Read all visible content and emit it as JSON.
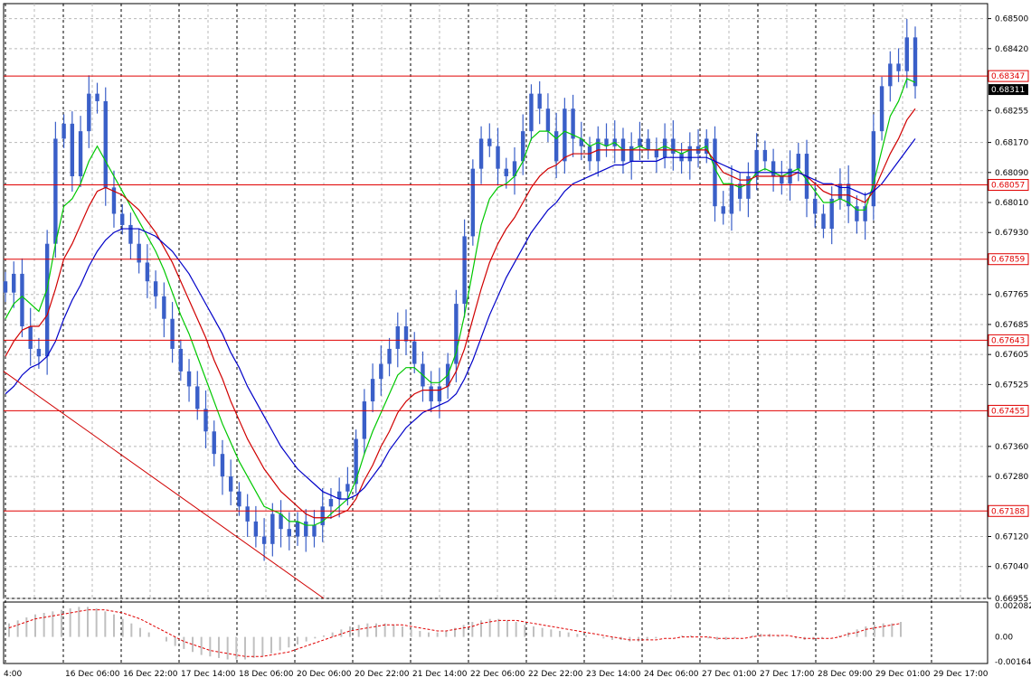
{
  "chart_data": [
    {
      "type": "candlestick",
      "instrument_panel": "main",
      "ylim": [
        0.66955,
        0.6854
      ],
      "y_ticks": [
        "0.68500",
        "0.68420",
        "0.68255",
        "0.68170",
        "0.68090",
        "0.68010",
        "0.67930",
        "0.67765",
        "0.67685",
        "0.67605",
        "0.67525",
        "0.67360",
        "0.67280",
        "0.67120",
        "0.67040",
        "0.66955"
      ],
      "x_ticks": [
        "4:00",
        "16 Dec 06:00",
        "16 Dec 22:00",
        "17 Dec 14:00",
        "18 Dec 06:00",
        "20 Dec 06:00",
        "20 Dec 22:00",
        "21 Dec 14:00",
        "22 Dec 06:00",
        "22 Dec 22:00",
        "23 Dec 14:00",
        "24 Dec 06:00",
        "27 Dec 01:00",
        "27 Dec 17:00",
        "28 Dec 09:00",
        "29 Dec 01:00",
        "29 Dec 17:00"
      ],
      "horizontal_levels": [
        "0.68347",
        "0.68057",
        "0.67859",
        "0.67643",
        "0.67455",
        "0.67188"
      ],
      "current_price": "0.68311",
      "close_series": [
        0.6777,
        0.6782,
        0.6768,
        0.6762,
        0.676,
        0.679,
        0.6818,
        0.6822,
        0.6808,
        0.682,
        0.683,
        0.6828,
        0.6805,
        0.6798,
        0.6795,
        0.679,
        0.6785,
        0.678,
        0.6776,
        0.677,
        0.6762,
        0.6756,
        0.6752,
        0.6746,
        0.674,
        0.6734,
        0.6728,
        0.6724,
        0.672,
        0.6716,
        0.6712,
        0.671,
        0.6718,
        0.6714,
        0.6712,
        0.6716,
        0.6712,
        0.6715,
        0.672,
        0.6722,
        0.6724,
        0.6726,
        0.6738,
        0.6748,
        0.6754,
        0.6758,
        0.6762,
        0.6768,
        0.6764,
        0.6758,
        0.6752,
        0.6748,
        0.6752,
        0.6758,
        0.6774,
        0.6792,
        0.681,
        0.6818,
        0.6816,
        0.681,
        0.6808,
        0.6812,
        0.682,
        0.683,
        0.6826,
        0.682,
        0.6812,
        0.6826,
        0.6818,
        0.6816,
        0.6812,
        0.6818,
        0.6816,
        0.6818,
        0.6812,
        0.6816,
        0.6818,
        0.6815,
        0.6813,
        0.6818,
        0.6814,
        0.6812,
        0.6816,
        0.6814,
        0.6818,
        0.68,
        0.6798,
        0.6806,
        0.6802,
        0.6808,
        0.6815,
        0.6812,
        0.6808,
        0.6806,
        0.681,
        0.6814,
        0.6802,
        0.6798,
        0.6794,
        0.6802,
        0.6806,
        0.68,
        0.6796,
        0.68,
        0.682,
        0.6832,
        0.6838,
        0.6836,
        0.6845,
        0.6832
      ],
      "moving_averages": [
        {
          "color": "#00c800",
          "values": [
            0.677,
            0.6774,
            0.6776,
            0.6774,
            0.6772,
            0.6778,
            0.679,
            0.68,
            0.6802,
            0.6806,
            0.6812,
            0.6816,
            0.6812,
            0.6808,
            0.6804,
            0.68,
            0.6796,
            0.6792,
            0.6788,
            0.6783,
            0.6777,
            0.6771,
            0.6766,
            0.676,
            0.6754,
            0.6748,
            0.6742,
            0.6737,
            0.6732,
            0.6728,
            0.6724,
            0.672,
            0.6719,
            0.6718,
            0.6716,
            0.6716,
            0.6715,
            0.6715,
            0.6716,
            0.6718,
            0.672,
            0.6722,
            0.6727,
            0.6734,
            0.674,
            0.6745,
            0.675,
            0.6755,
            0.6757,
            0.6757,
            0.6755,
            0.6753,
            0.6753,
            0.6755,
            0.6761,
            0.6771,
            0.6783,
            0.6795,
            0.6802,
            0.6805,
            0.6806,
            0.6808,
            0.6812,
            0.6818,
            0.682,
            0.682,
            0.6818,
            0.682,
            0.6819,
            0.6818,
            0.6816,
            0.6817,
            0.6816,
            0.6817,
            0.6815,
            0.6815,
            0.6816,
            0.6815,
            0.6815,
            0.6816,
            0.6815,
            0.6814,
            0.6815,
            0.6815,
            0.6816,
            0.681,
            0.6806,
            0.6806,
            0.6805,
            0.6806,
            0.6809,
            0.681,
            0.6809,
            0.6808,
            0.6809,
            0.681,
            0.6807,
            0.6804,
            0.6801,
            0.6801,
            0.6802,
            0.6801,
            0.6799,
            0.6799,
            0.6806,
            0.6815,
            0.6824,
            0.6828,
            0.6834,
            0.6833
          ]
        },
        {
          "color": "#d00000",
          "values": [
            0.676,
            0.6764,
            0.6767,
            0.6768,
            0.6768,
            0.6771,
            0.6778,
            0.6786,
            0.679,
            0.6795,
            0.68,
            0.6804,
            0.6805,
            0.6804,
            0.6803,
            0.6801,
            0.6799,
            0.6796,
            0.6793,
            0.6789,
            0.6785,
            0.678,
            0.6775,
            0.677,
            0.6765,
            0.6759,
            0.6754,
            0.6748,
            0.6743,
            0.6738,
            0.6734,
            0.673,
            0.6727,
            0.6724,
            0.6722,
            0.672,
            0.6718,
            0.6717,
            0.6717,
            0.6717,
            0.6718,
            0.6719,
            0.6722,
            0.6727,
            0.6731,
            0.6736,
            0.674,
            0.6745,
            0.6748,
            0.675,
            0.6751,
            0.6751,
            0.6751,
            0.6752,
            0.6756,
            0.6762,
            0.677,
            0.6778,
            0.6785,
            0.679,
            0.6794,
            0.6797,
            0.6801,
            0.6805,
            0.6808,
            0.681,
            0.6811,
            0.6813,
            0.6814,
            0.6814,
            0.6814,
            0.6815,
            0.6815,
            0.6815,
            0.6815,
            0.6815,
            0.6815,
            0.6815,
            0.6815,
            0.6815,
            0.6815,
            0.6815,
            0.6815,
            0.6815,
            0.6815,
            0.6812,
            0.6809,
            0.6808,
            0.6807,
            0.6807,
            0.6808,
            0.6808,
            0.6808,
            0.6808,
            0.6808,
            0.6809,
            0.6808,
            0.6806,
            0.6804,
            0.6803,
            0.6803,
            0.6803,
            0.6802,
            0.6801,
            0.6804,
            0.6809,
            0.6814,
            0.6818,
            0.6823,
            0.6826
          ]
        },
        {
          "color": "#0000c8",
          "values": [
            0.675,
            0.6752,
            0.6755,
            0.6757,
            0.6758,
            0.676,
            0.6764,
            0.677,
            0.6775,
            0.6779,
            0.6784,
            0.6788,
            0.6791,
            0.6793,
            0.6794,
            0.6794,
            0.6794,
            0.6793,
            0.6792,
            0.679,
            0.6788,
            0.6785,
            0.6782,
            0.6778,
            0.6774,
            0.677,
            0.6766,
            0.6761,
            0.6757,
            0.6752,
            0.6748,
            0.6744,
            0.674,
            0.6736,
            0.6733,
            0.673,
            0.6728,
            0.6726,
            0.6724,
            0.6723,
            0.6722,
            0.6722,
            0.6723,
            0.6725,
            0.6728,
            0.6731,
            0.6735,
            0.6738,
            0.6741,
            0.6743,
            0.6745,
            0.6746,
            0.6747,
            0.6748,
            0.675,
            0.6754,
            0.6759,
            0.6765,
            0.6771,
            0.6776,
            0.6781,
            0.6785,
            0.6789,
            0.6793,
            0.6796,
            0.6799,
            0.6801,
            0.6804,
            0.6806,
            0.6807,
            0.6808,
            0.6809,
            0.681,
            0.6811,
            0.6811,
            0.6812,
            0.6812,
            0.6812,
            0.6812,
            0.6813,
            0.6813,
            0.6813,
            0.6813,
            0.6813,
            0.6813,
            0.6812,
            0.6811,
            0.681,
            0.6809,
            0.6809,
            0.6809,
            0.6809,
            0.6809,
            0.6809,
            0.6809,
            0.6809,
            0.6808,
            0.6807,
            0.6806,
            0.6806,
            0.6805,
            0.6805,
            0.6804,
            0.6803,
            0.6804,
            0.6806,
            0.6809,
            0.6812,
            0.6815,
            0.6818
          ]
        }
      ]
    },
    {
      "type": "histogram",
      "instrument_panel": "oscillator",
      "y_ticks": [
        "0.002082",
        "0.00",
        "-0.001648"
      ],
      "ylim": [
        -0.001648,
        0.002082
      ],
      "values": [
        0.0009,
        0.0011,
        0.0013,
        0.0015,
        0.0016,
        0.0017,
        0.0018,
        0.0019,
        0.002,
        0.002,
        0.0019,
        0.0017,
        0.0015,
        0.0012,
        0.0009,
        0.0006,
        0.0003,
        0.0,
        -0.0003,
        -0.0006,
        -0.0008,
        -0.001,
        -0.0012,
        -0.0013,
        -0.0014,
        -0.0015,
        -0.0015,
        -0.0015,
        -0.0014,
        -0.0013,
        -0.0011,
        -0.0009,
        -0.0007,
        -0.0005,
        -0.0003,
        -0.0001,
        0.0001,
        0.0003,
        0.0005,
        0.0007,
        0.0008,
        0.0009,
        0.0009,
        0.0009,
        0.0008,
        0.0007,
        0.0005,
        0.0004,
        0.0003,
        0.0003,
        0.0004,
        0.0006,
        0.0008,
        0.001,
        0.0011,
        0.0012,
        0.0012,
        0.0011,
        0.001,
        0.0008,
        0.0007,
        0.0006,
        0.0005,
        0.0004,
        0.0003,
        0.0002,
        0.0001,
        0.0,
        -0.0001,
        -0.0002,
        -0.0002,
        -0.0003,
        -0.0003,
        -0.0002,
        -0.0001,
        0.0,
        0.0,
        0.0001,
        0.0001,
        0.0,
        -0.0001,
        -0.0002,
        -0.0002,
        -0.0001,
        0.0,
        0.0001,
        0.0002,
        0.0002,
        0.0001,
        0.0,
        -0.0001,
        -0.0002,
        -0.0002,
        -0.0001,
        0.0,
        0.0001,
        0.0003,
        0.0005,
        0.0007,
        0.0008,
        0.0009,
        0.0009,
        0.001
      ],
      "signal": [
        0.0006,
        0.0008,
        0.001,
        0.0012,
        0.0013,
        0.0014,
        0.0015,
        0.0016,
        0.0017,
        0.0018,
        0.0018,
        0.0018,
        0.0017,
        0.0016,
        0.0014,
        0.0012,
        0.0009,
        0.0006,
        0.0003,
        0.0,
        -0.0003,
        -0.0005,
        -0.0007,
        -0.0009,
        -0.001,
        -0.0011,
        -0.0012,
        -0.0013,
        -0.0013,
        -0.0013,
        -0.0012,
        -0.0011,
        -0.001,
        -0.0008,
        -0.0006,
        -0.0004,
        -0.0002,
        0.0,
        0.0002,
        0.0004,
        0.0005,
        0.0006,
        0.0007,
        0.0008,
        0.0008,
        0.0008,
        0.0007,
        0.0006,
        0.0005,
        0.0004,
        0.0004,
        0.0005,
        0.0006,
        0.0007,
        0.0009,
        0.001,
        0.0011,
        0.0011,
        0.0011,
        0.001,
        0.0009,
        0.0008,
        0.0007,
        0.0006,
        0.0005,
        0.0004,
        0.0003,
        0.0002,
        0.0001,
        0.0,
        -0.0001,
        -0.0002,
        -0.0002,
        -0.0002,
        -0.0002,
        -0.0001,
        -0.0001,
        0.0,
        0.0,
        0.0,
        0.0,
        -0.0001,
        -0.0001,
        -0.0001,
        -0.0001,
        0.0,
        0.0001,
        0.0001,
        0.0001,
        0.0001,
        0.0,
        -0.0001,
        -0.0001,
        -0.0001,
        -0.0001,
        0.0,
        0.0002,
        0.0003,
        0.0005,
        0.0006,
        0.0007,
        0.0008,
        0.0009
      ]
    }
  ],
  "colors": {
    "candle": "#3a5fc8",
    "level": "#e00000",
    "grid": "#b8b8b8",
    "axis_text": "#000000",
    "trendline": "#d00000",
    "osc_bar": "#c0c0c0",
    "osc_signal": "#e00000"
  }
}
